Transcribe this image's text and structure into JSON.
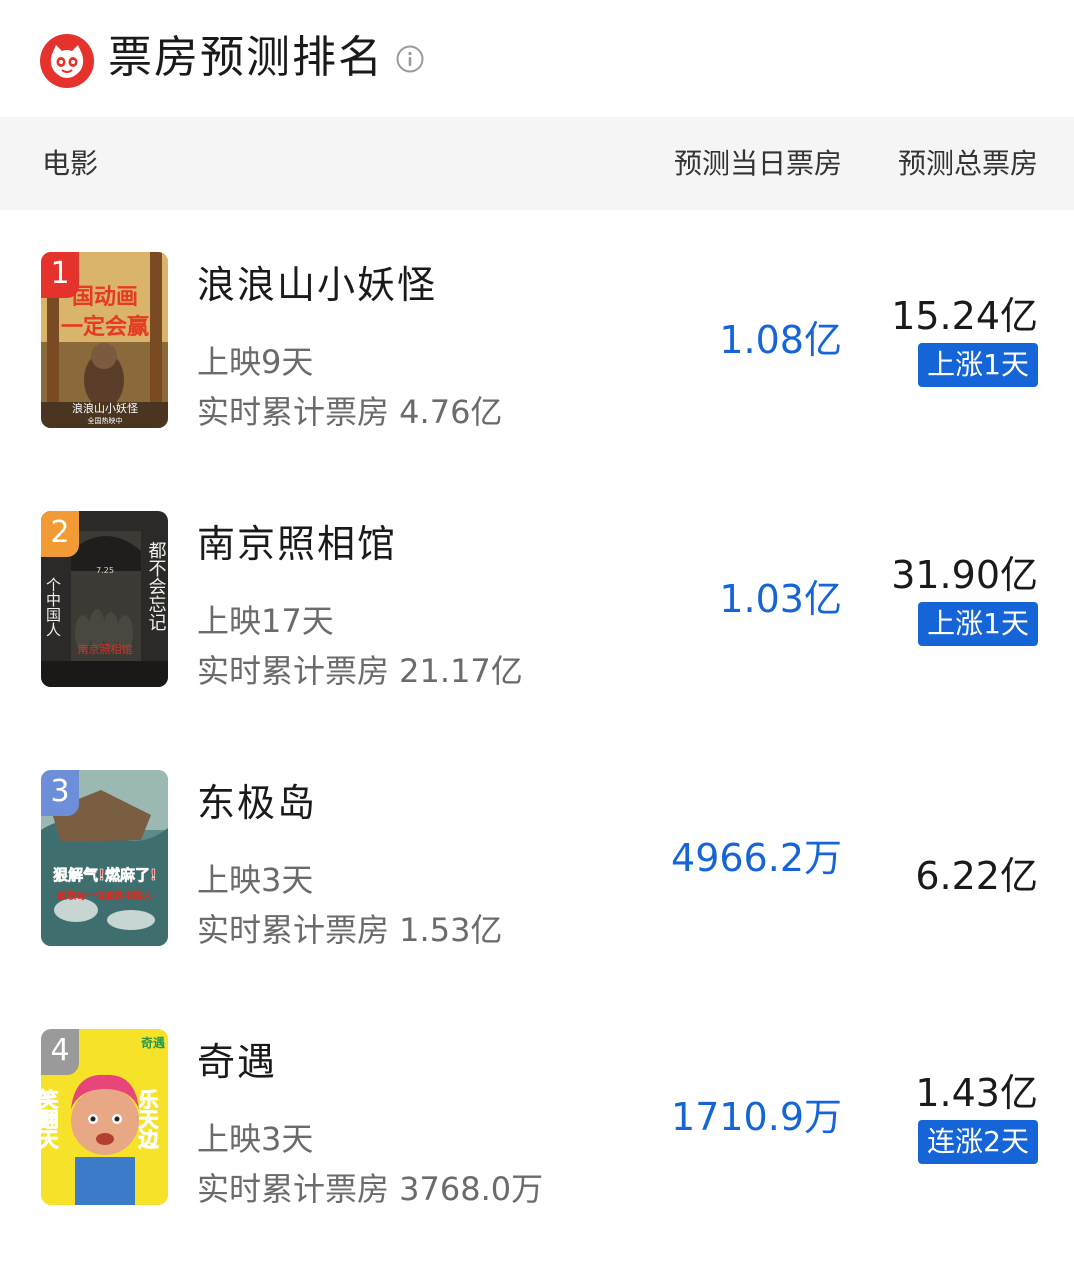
{
  "header": {
    "title": "票房预测排名"
  },
  "columns": {
    "movie": "电影",
    "day_forecast": "预测当日票房",
    "total_forecast": "预测总票房"
  },
  "colors": {
    "accent_blue": "#1565d8",
    "logo_red": "#e5322d",
    "rank_1": "#e5322d",
    "rank_2": "#f29a33",
    "rank_3": "#6d8fd9",
    "rank_4": "#9a9a9a"
  },
  "movies": [
    {
      "rank": "1",
      "title": "浪浪山小妖怪",
      "days": "上映9天",
      "cumulative": "实时累计票房 4.76亿",
      "day_forecast": "1.08亿",
      "total_forecast": "15.24亿",
      "tag": "上涨1天",
      "poster": {
        "line1": "国动画",
        "line2": "一定会赢",
        "bottom": "浪浪山小妖怪",
        "sub": "全国热映中"
      }
    },
    {
      "rank": "2",
      "title": "南京照相馆",
      "days": "上映17天",
      "cumulative": "实时累计票房 21.17亿",
      "day_forecast": "1.03亿",
      "total_forecast": "31.90亿",
      "tag": "上涨1天",
      "poster": {
        "left_text": "个中国人",
        "right_text": "都不会忘记",
        "center": "南京照相馆",
        "date": "7.25"
      }
    },
    {
      "rank": "3",
      "title": "东极岛",
      "days": "上映3天",
      "cumulative": "实时累计票房 1.53亿",
      "day_forecast": "4966.2万",
      "total_forecast": "6.22亿",
      "tag": "",
      "poster": {
        "line1": "狠解气!燃麻了!",
        "line2": "致敬每一位血性中国人"
      }
    },
    {
      "rank": "4",
      "title": "奇遇",
      "days": "上映3天",
      "cumulative": "实时累计票房 3768.0万",
      "day_forecast": "1710.9万",
      "total_forecast": "1.43亿",
      "tag": "连涨2天",
      "poster": {
        "left_text": "笑翻天",
        "right_text": "乐天边",
        "top": "奇遇"
      }
    }
  ]
}
